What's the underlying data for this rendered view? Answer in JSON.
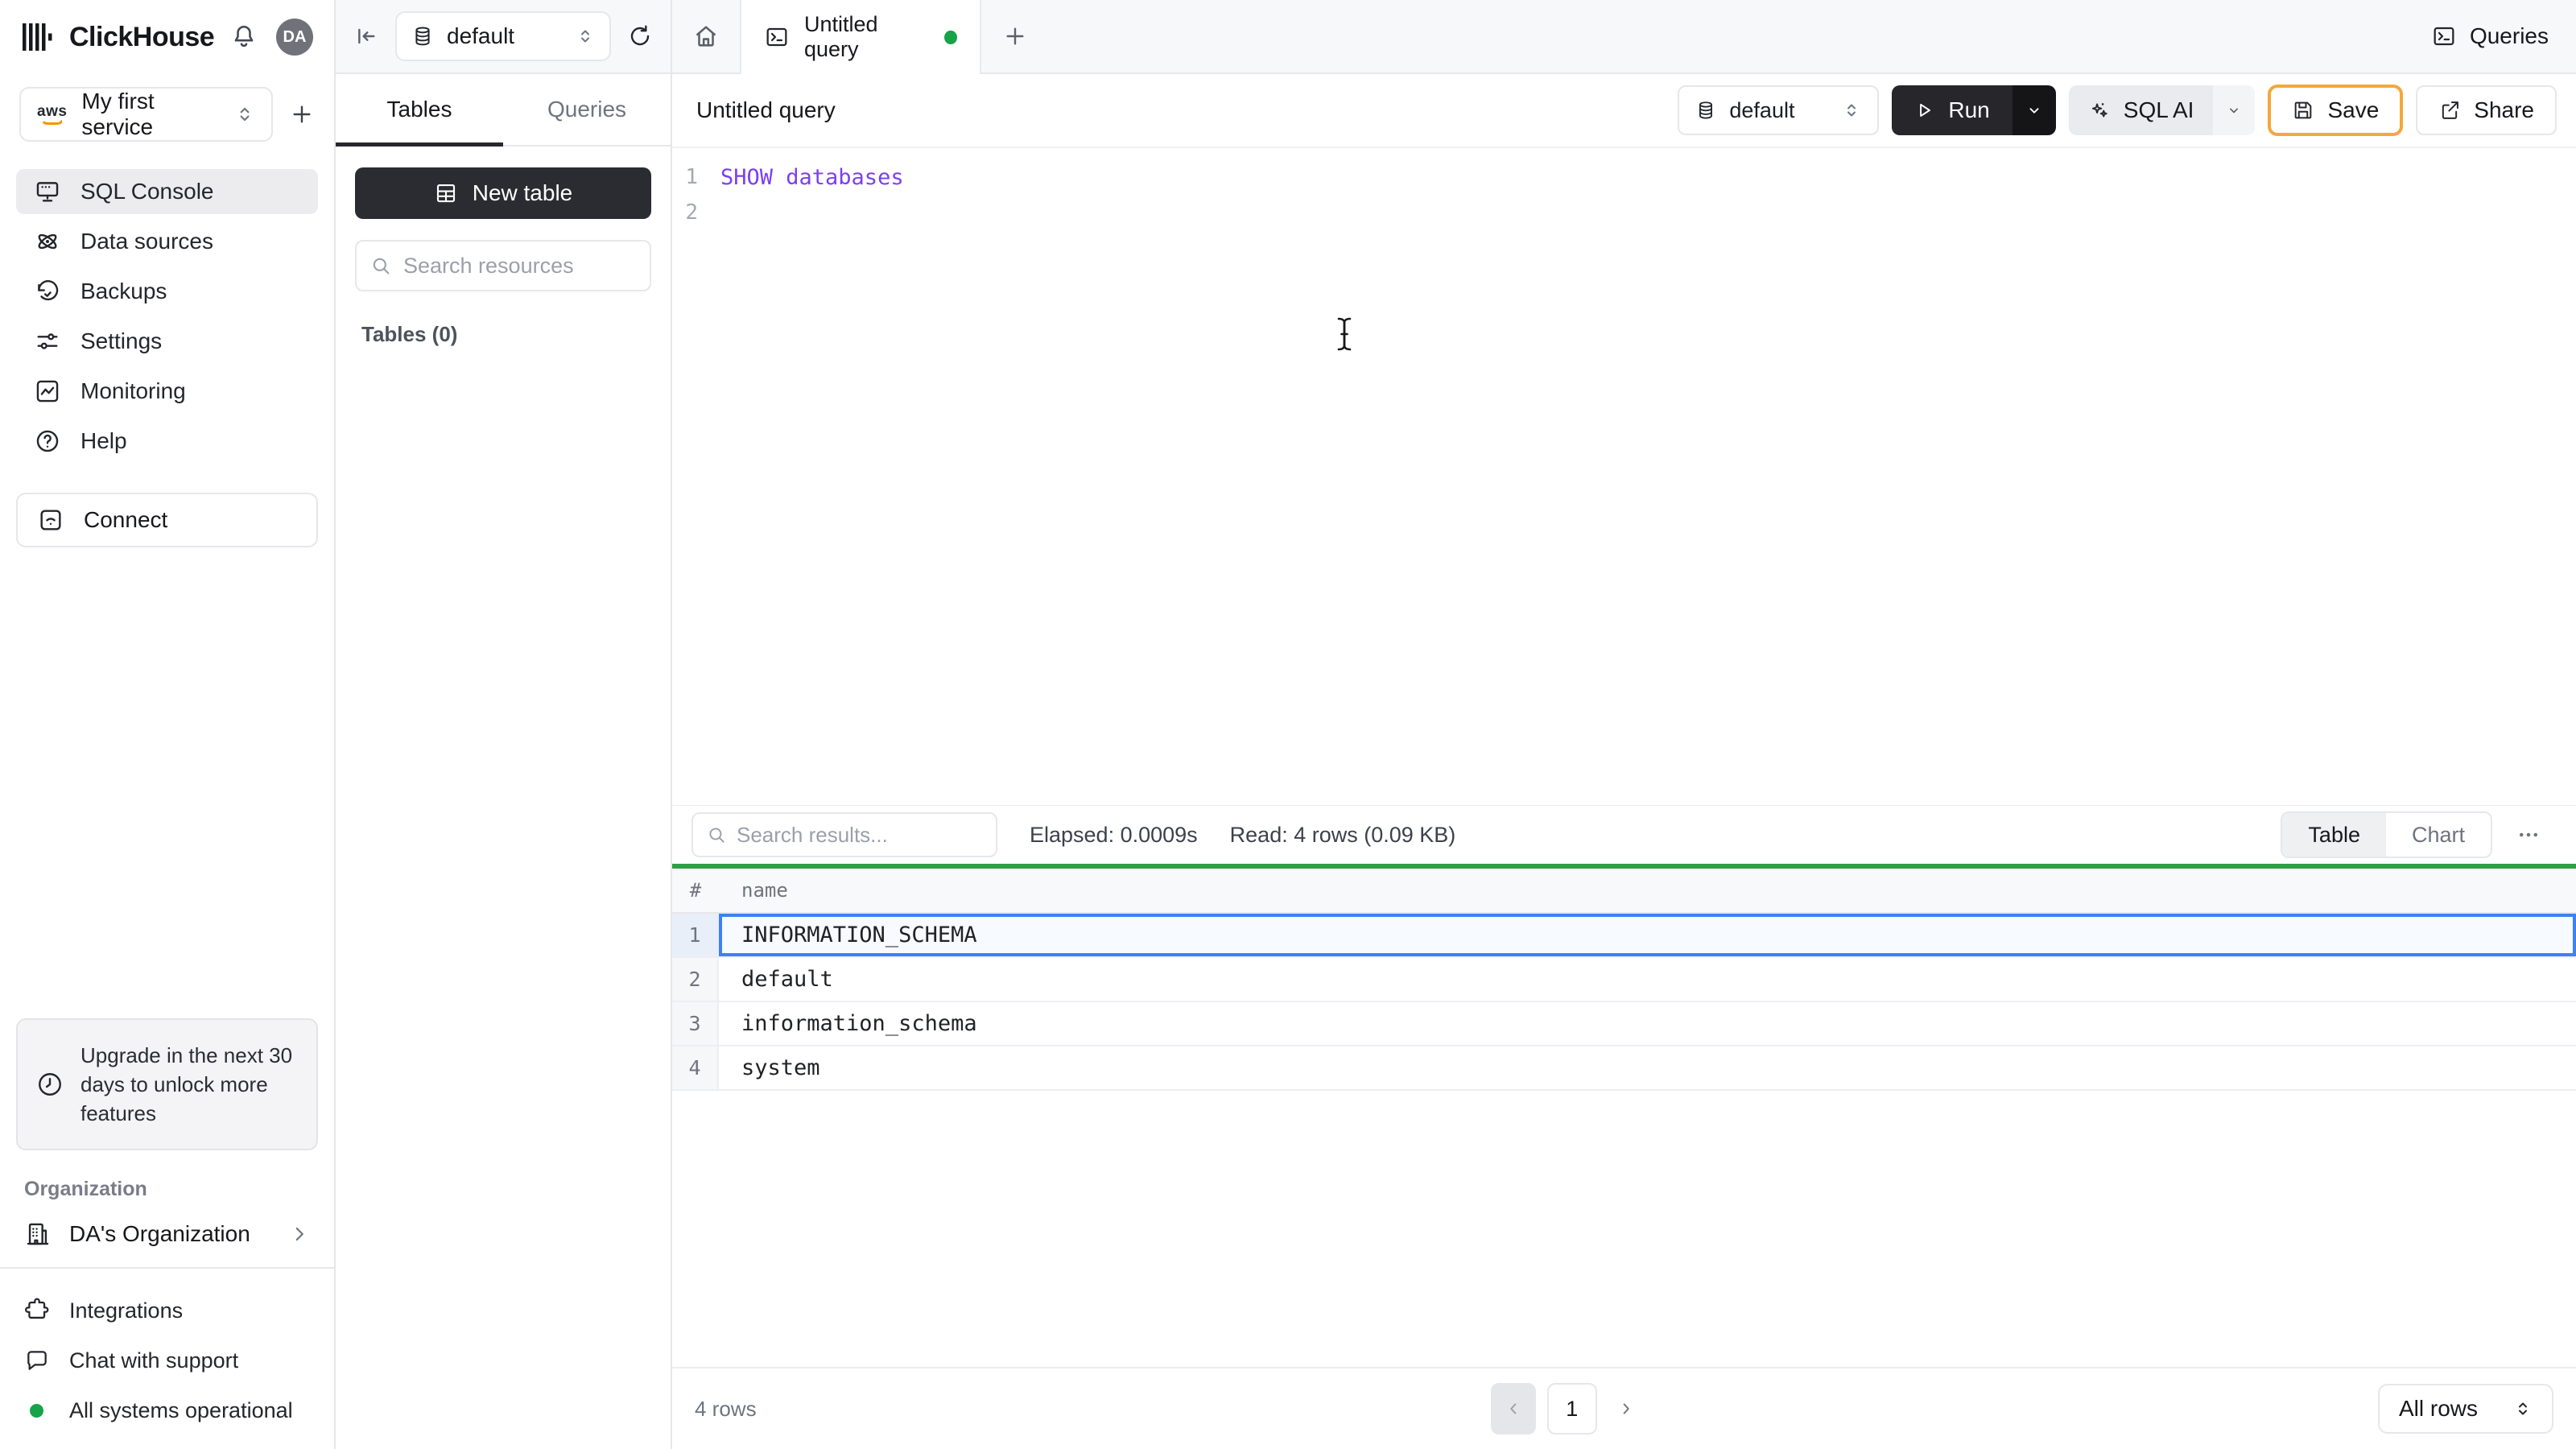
{
  "brand": {
    "name": "ClickHouse",
    "avatar": "DA"
  },
  "sidebar": {
    "service": {
      "provider": "aws",
      "name": "My first service"
    },
    "nav": [
      {
        "label": "SQL Console",
        "active": true
      },
      {
        "label": "Data sources"
      },
      {
        "label": "Backups"
      },
      {
        "label": "Settings"
      },
      {
        "label": "Monitoring"
      },
      {
        "label": "Help"
      }
    ],
    "connect": "Connect",
    "upgrade": "Upgrade in the next 30 days to unlock more features",
    "org_section": "Organization",
    "org_name": "DA's Organization",
    "integrations": "Integrations",
    "chat": "Chat with support",
    "status": "All systems operational"
  },
  "browser": {
    "database": "default",
    "tab_tables": "Tables",
    "tab_queries": "Queries",
    "new_table": "New table",
    "search_placeholder": "Search resources",
    "tables_count": "Tables (0)"
  },
  "main": {
    "tab": "Untitled query",
    "queries_button": "Queries",
    "toolbar": {
      "title": "Untitled query",
      "database": "default",
      "run": "Run",
      "sql_ai": "SQL AI",
      "save": "Save",
      "share": "Share"
    },
    "editor": {
      "line1_no": "1",
      "line1_code": "SHOW databases",
      "line2_no": "2"
    },
    "results": {
      "search_placeholder": "Search results...",
      "elapsed": "Elapsed: 0.0009s",
      "read": "Read: 4 rows (0.09 KB)",
      "toggle_table": "Table",
      "toggle_chart": "Chart",
      "col_hash": "#",
      "col_name": "name",
      "rows": [
        {
          "no": "1",
          "name": "INFORMATION_SCHEMA",
          "selected": true
        },
        {
          "no": "2",
          "name": "default"
        },
        {
          "no": "3",
          "name": "information_schema"
        },
        {
          "no": "4",
          "name": "system"
        }
      ],
      "footer": {
        "count": "4 rows",
        "page": "1",
        "page_size": "All rows"
      }
    }
  },
  "colors": {
    "accent_green": "#2f9e44",
    "status_green": "#16a34a",
    "save_border": "#f5a73b",
    "selected_blue": "#3b82f6",
    "code_purple": "#7b3ff2",
    "dark_button": "#26262b"
  }
}
